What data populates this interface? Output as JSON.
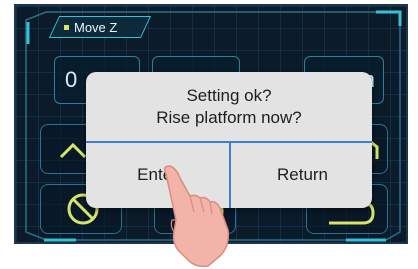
{
  "screen": {
    "title": "Move Z",
    "background_color": "#0b1b2a",
    "accent_color": "#34c2d6",
    "partial_readouts": {
      "left": "0",
      "right": "m"
    }
  },
  "dialog": {
    "line1": "Setting ok?",
    "line2": "Rise platform now?",
    "enter_label": "Enter",
    "return_label": "Return",
    "background_color": "#e3e3e3",
    "divider_color": "#3f7fcf"
  },
  "icons": {
    "hand": "pointing-hand-icon",
    "up_arrow_left": "up-arrow-icon",
    "home_right": "home-icon",
    "circle_slash": "circle-slash-icon",
    "zero_mark": "zero-icon",
    "return_arrow": "return-arrow-icon"
  }
}
